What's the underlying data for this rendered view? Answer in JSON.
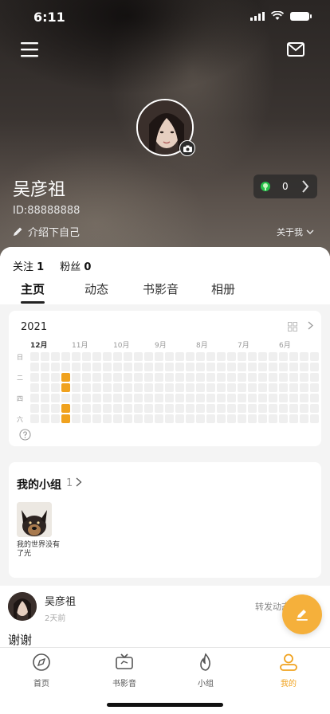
{
  "status_bar": {
    "time": "6:11"
  },
  "profile": {
    "name": "吴彦祖",
    "id_text": "ID:88888888",
    "intro_text": "介绍下自己",
    "about_label": "关于我",
    "coins": "0"
  },
  "stats": {
    "following_label": "关注",
    "following_count": "1",
    "fans_label": "粉丝",
    "fans_count": "0"
  },
  "tabs": [
    {
      "label": "主页"
    },
    {
      "label": "动态"
    },
    {
      "label": "书影音"
    },
    {
      "label": "相册"
    }
  ],
  "calendar": {
    "year": "2021",
    "months": [
      "12月",
      "11月",
      "10月",
      "9月",
      "8月",
      "7月",
      "6月"
    ],
    "day_labels": [
      "日",
      "二",
      "四",
      "六"
    ],
    "active_cells": [
      [
        3,
        2
      ],
      [
        3,
        3
      ],
      [
        3,
        5
      ],
      [
        3,
        6
      ]
    ]
  },
  "groups": {
    "title": "我的小组",
    "count": "1",
    "items": [
      {
        "name": "我的世界没有了光"
      }
    ]
  },
  "post": {
    "author": "吴彦祖",
    "time": "2天前",
    "forward_label": "转发动态",
    "text": "谢谢"
  },
  "bottom_nav": [
    {
      "label": "首页",
      "icon": "compass-icon"
    },
    {
      "label": "书影音",
      "icon": "tv-icon"
    },
    {
      "label": "小组",
      "icon": "flame-icon"
    },
    {
      "label": "我的",
      "icon": "person-icon"
    }
  ],
  "colors": {
    "accent": "#f0a21e",
    "fab": "#f5b03b"
  }
}
